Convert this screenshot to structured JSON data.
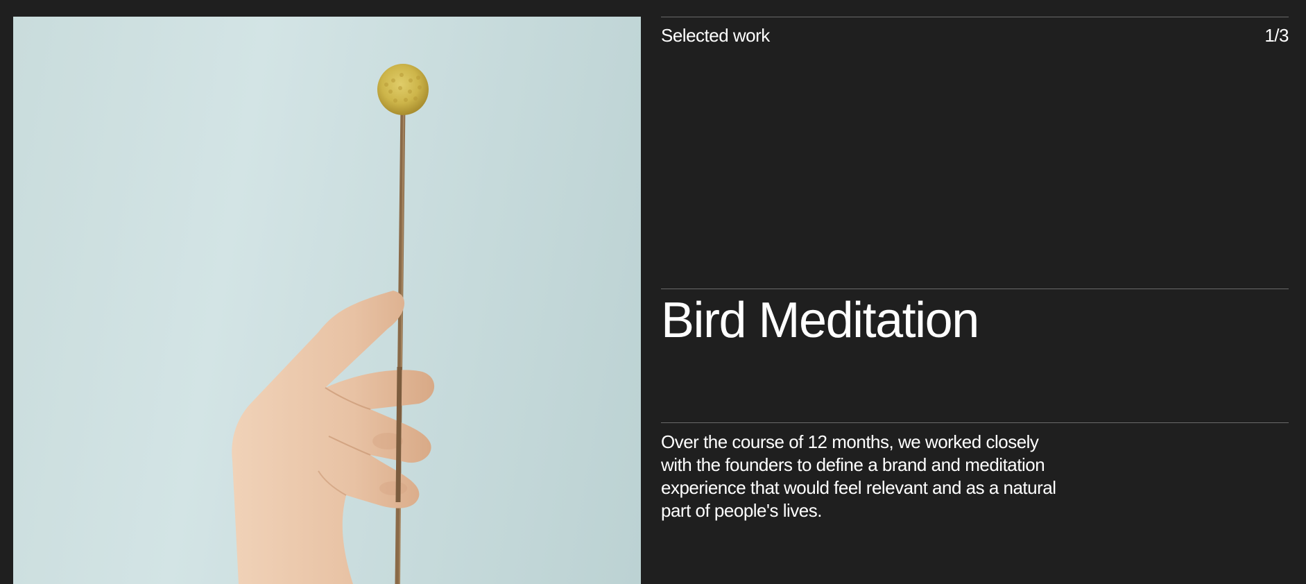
{
  "project": {
    "section_label": "Selected work",
    "counter": "1/3",
    "title": "Bird Meditation",
    "description": "Over the course of 12 months, we worked closely with the founders to define a brand and meditation experience that would feel relevant and as a natural part of people's lives."
  },
  "colors": {
    "background": "#1f1f1f",
    "text": "#ffffff",
    "divider": "#6a6a6a",
    "photo_sky": "#cfe1e1",
    "flower": "#cdb54a",
    "stem": "#8a6a48",
    "skin": "#e8c2a4"
  },
  "image": {
    "subject": "hand-holding-dried-flower"
  }
}
